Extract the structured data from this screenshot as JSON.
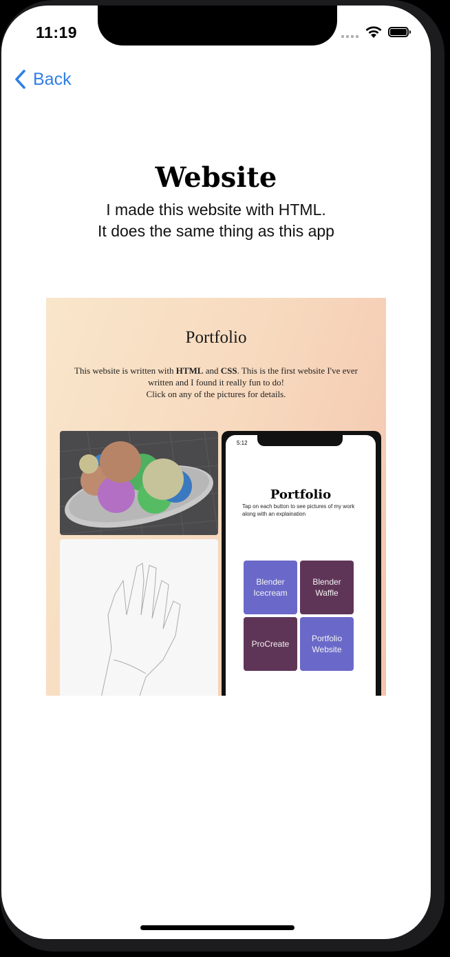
{
  "status_bar": {
    "time": "11:19",
    "icons": [
      "signal-icon",
      "wifi-icon",
      "battery-icon"
    ]
  },
  "nav": {
    "back_label": "Back",
    "back_icon": "chevron-left-icon",
    "accent": "#2f7ee4"
  },
  "page": {
    "title": "Website",
    "subtitle_line1": "I made this website with HTML.",
    "subtitle_line2": "It does the same thing as this app"
  },
  "preview": {
    "title": "Portfolio",
    "text_part1": "This website is written with ",
    "text_html": "HTML",
    "text_and": " and ",
    "text_css": "CSS",
    "text_part2": ". This is the first website I've ever written and I found it really fun to do!",
    "text_line3": "Click on any of the pictures for details.",
    "app_screenshot": {
      "time": "5:12",
      "title": "Portfolio",
      "description": "Tap on each button to see pictures of my work along with an explaination",
      "buttons": [
        {
          "label": "Blender Icecream",
          "color": "#6a69c9"
        },
        {
          "label": "Blender Waffle",
          "color": "#5f3557"
        },
        {
          "label": "ProCreate",
          "color": "#5f3557"
        },
        {
          "label": "Portfolio Website",
          "color": "#6a69c9"
        }
      ]
    }
  }
}
